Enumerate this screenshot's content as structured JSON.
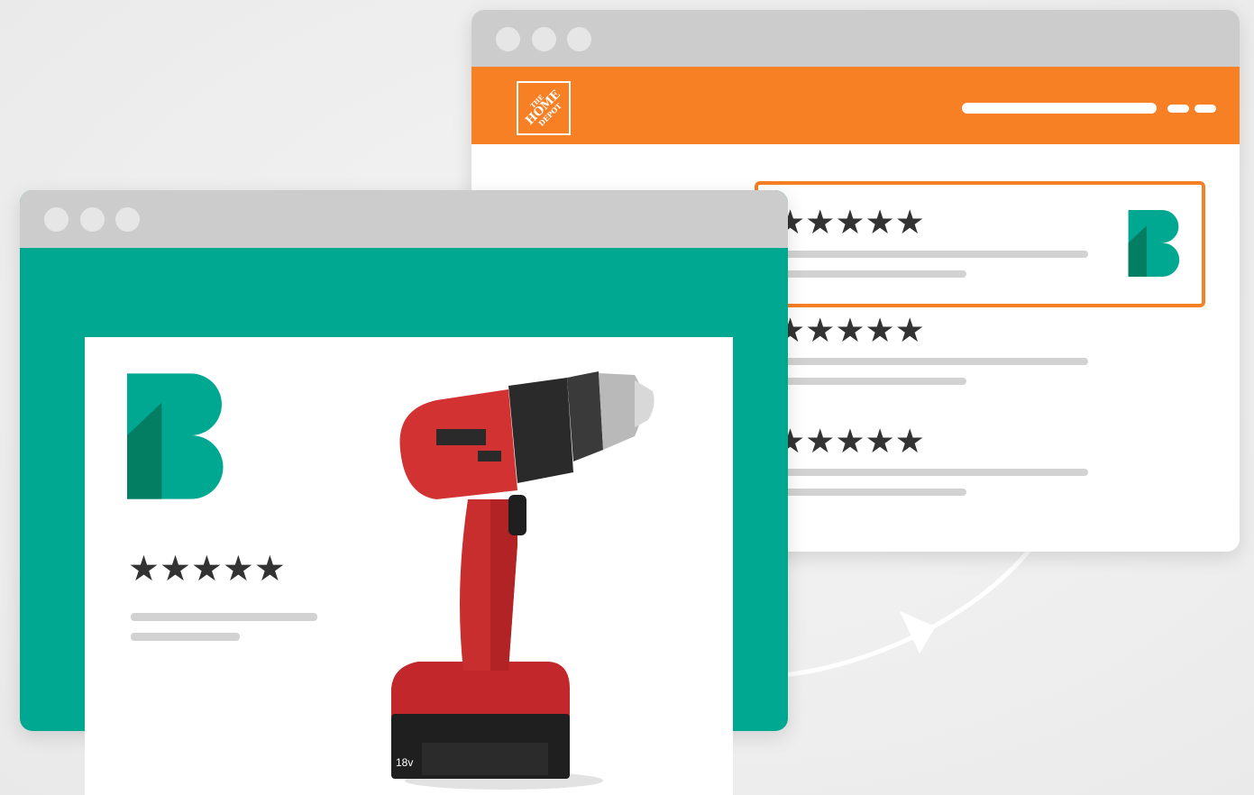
{
  "theme": {
    "teal": "#00a891",
    "teal_dark": "#047e62",
    "orange": "#f77f24",
    "gray_bar": "#cccccc",
    "text_dark": "#333333"
  },
  "store_window": {
    "brand_logo": {
      "icon": "home-depot-logo",
      "text": "THE HOME DEPOT"
    },
    "reviews": [
      {
        "stars": "★★★★★",
        "highlighted": true,
        "has_brand_badge": true
      },
      {
        "stars": "★★★★★",
        "highlighted": false,
        "has_brand_badge": false
      },
      {
        "stars": "★★★★★",
        "highlighted": false,
        "has_brand_badge": false
      }
    ]
  },
  "brand_window": {
    "logo_icon": "bazaarvoice-b-logo",
    "review": {
      "stars": "★★★★★"
    },
    "product": {
      "icon": "cordless-drill-image",
      "battery_label": "18v"
    }
  },
  "sync_arrow": {
    "icon": "sync-arrow-icon"
  }
}
